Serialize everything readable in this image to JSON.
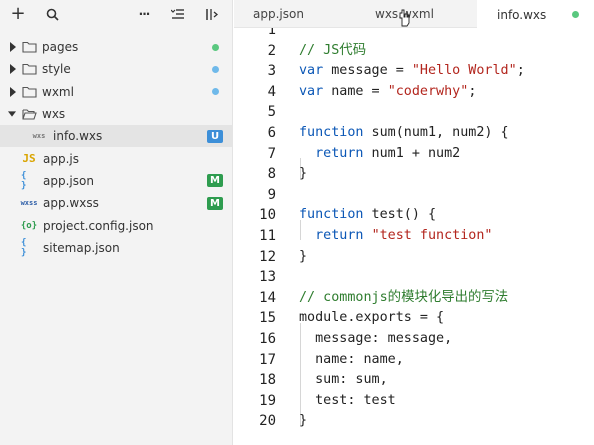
{
  "colors": {
    "folder": "#555555",
    "dot_green": "#5ac87f",
    "dot_blue": "#6fb9ea",
    "badge_u": "#3d8fd8",
    "badge_m": "#2e9c4f",
    "js_icon": "#d9a400",
    "json_icon": "#3d8fd8",
    "wxss_icon": "#2f5fa8",
    "config_icon": "#2e9c4f",
    "keyword": "#0b57b6",
    "string": "#b3261e",
    "comment": "#2f7d2f"
  },
  "toolbar": {
    "add": "+",
    "more": "···"
  },
  "tree": [
    {
      "label": "pages",
      "type": "folder",
      "expanded": false,
      "status": "dot-green"
    },
    {
      "label": "style",
      "type": "folder",
      "expanded": false,
      "status": "dot-blue"
    },
    {
      "label": "wxml",
      "type": "folder",
      "expanded": false,
      "status": "dot-blue"
    },
    {
      "label": "wxs",
      "type": "folder",
      "expanded": true,
      "status": ""
    },
    {
      "label": "info.wxs",
      "type": "wxs",
      "icon_text": "wxs",
      "status": "U",
      "selected": true
    },
    {
      "label": "app.js",
      "type": "js",
      "icon_text": "JS",
      "status": ""
    },
    {
      "label": "app.json",
      "type": "json",
      "icon_text": "{ }",
      "status": "M"
    },
    {
      "label": "app.wxss",
      "type": "wxss",
      "icon_text": "wxss",
      "status": "M"
    },
    {
      "label": "project.config.json",
      "type": "config",
      "icon_text": "{o}",
      "status": ""
    },
    {
      "label": "sitemap.json",
      "type": "json",
      "icon_text": "{ }",
      "status": ""
    }
  ],
  "tabs": [
    {
      "label": "app.json",
      "active": false
    },
    {
      "label": "wxs.wxml",
      "active": false
    },
    {
      "label": "info.wxs",
      "active": true,
      "status": "dot-green"
    }
  ],
  "editor": {
    "lines": [
      {
        "n": "1",
        "tokens": []
      },
      {
        "n": "2",
        "tokens": [
          {
            "t": "// JS代码",
            "c": "cmt"
          }
        ]
      },
      {
        "n": "3",
        "tokens": [
          {
            "t": "var",
            "c": "kw"
          },
          {
            "t": " message = ",
            "c": ""
          },
          {
            "t": "\"Hello World\"",
            "c": "str"
          },
          {
            "t": ";",
            "c": ""
          }
        ]
      },
      {
        "n": "4",
        "tokens": [
          {
            "t": "var",
            "c": "kw"
          },
          {
            "t": " name = ",
            "c": ""
          },
          {
            "t": "\"coderwhy\"",
            "c": "str"
          },
          {
            "t": ";",
            "c": ""
          }
        ]
      },
      {
        "n": "5",
        "tokens": []
      },
      {
        "n": "6",
        "tokens": [
          {
            "t": "function",
            "c": "kw"
          },
          {
            "t": " sum(num1, num2) {",
            "c": ""
          }
        ]
      },
      {
        "n": "7",
        "tokens": [
          {
            "t": "  ",
            "c": ""
          },
          {
            "t": "return",
            "c": "kw"
          },
          {
            "t": " num1 + num2",
            "c": ""
          }
        ]
      },
      {
        "n": "8",
        "tokens": [
          {
            "t": "}",
            "c": ""
          }
        ]
      },
      {
        "n": "9",
        "tokens": []
      },
      {
        "n": "10",
        "tokens": [
          {
            "t": "function",
            "c": "kw"
          },
          {
            "t": " test() {",
            "c": ""
          }
        ]
      },
      {
        "n": "11",
        "tokens": [
          {
            "t": "  ",
            "c": ""
          },
          {
            "t": "return",
            "c": "kw"
          },
          {
            "t": " ",
            "c": ""
          },
          {
            "t": "\"test function\"",
            "c": "str"
          }
        ]
      },
      {
        "n": "12",
        "tokens": [
          {
            "t": "}",
            "c": ""
          }
        ]
      },
      {
        "n": "13",
        "tokens": []
      },
      {
        "n": "14",
        "tokens": [
          {
            "t": "// commonjs的模块化导出的写法",
            "c": "cmt"
          }
        ]
      },
      {
        "n": "15",
        "tokens": [
          {
            "t": "module.exports = {",
            "c": ""
          }
        ]
      },
      {
        "n": "16",
        "tokens": [
          {
            "t": "  message: message,",
            "c": ""
          }
        ]
      },
      {
        "n": "17",
        "tokens": [
          {
            "t": "  name: name,",
            "c": ""
          }
        ]
      },
      {
        "n": "18",
        "tokens": [
          {
            "t": "  sum: sum,",
            "c": ""
          }
        ]
      },
      {
        "n": "19",
        "tokens": [
          {
            "t": "  test: test",
            "c": ""
          }
        ]
      },
      {
        "n": "20",
        "tokens": [
          {
            "t": "}",
            "c": ""
          }
        ]
      }
    ]
  }
}
